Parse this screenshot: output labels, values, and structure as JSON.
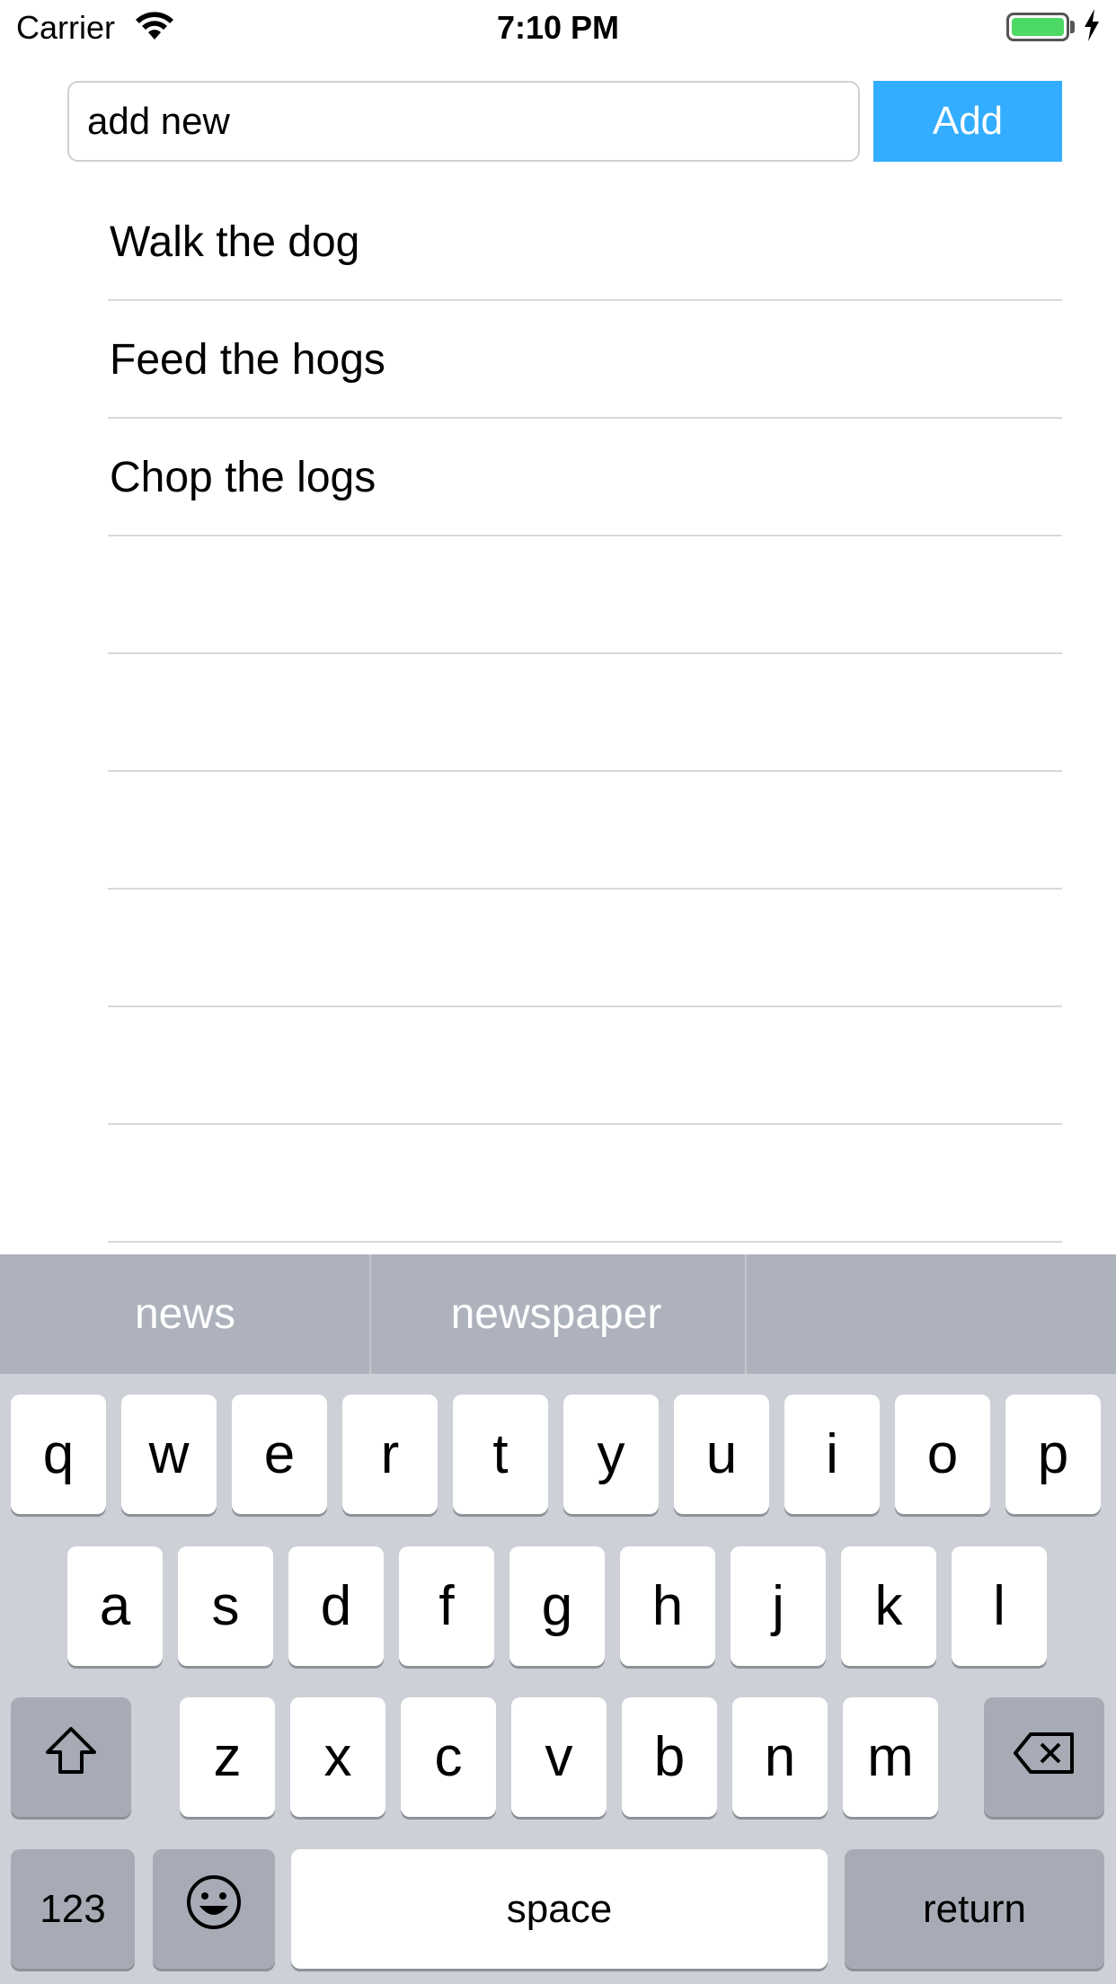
{
  "status_bar": {
    "carrier": "Carrier",
    "time": "7:10 PM",
    "battery_level": 1.0,
    "battery_color": "#4cd964"
  },
  "input": {
    "value": "add new"
  },
  "add_button": {
    "label": "Add",
    "color": "#33adff"
  },
  "list": {
    "items": [
      "Walk the dog",
      "Feed the hogs",
      "Chop the logs",
      "",
      "",
      "",
      "",
      "",
      ""
    ]
  },
  "keyboard": {
    "suggestions": [
      "news",
      "newspaper",
      ""
    ],
    "row1": [
      "q",
      "w",
      "e",
      "r",
      "t",
      "y",
      "u",
      "i",
      "o",
      "p"
    ],
    "row2": [
      "a",
      "s",
      "d",
      "f",
      "g",
      "h",
      "j",
      "k",
      "l"
    ],
    "row3": [
      "z",
      "x",
      "c",
      "v",
      "b",
      "n",
      "m"
    ],
    "numbers_label": "123",
    "space_label": "space",
    "return_label": "return",
    "icons": {
      "shift": "shift-icon",
      "backspace": "backspace-icon",
      "emoji": "emoji-icon"
    }
  }
}
